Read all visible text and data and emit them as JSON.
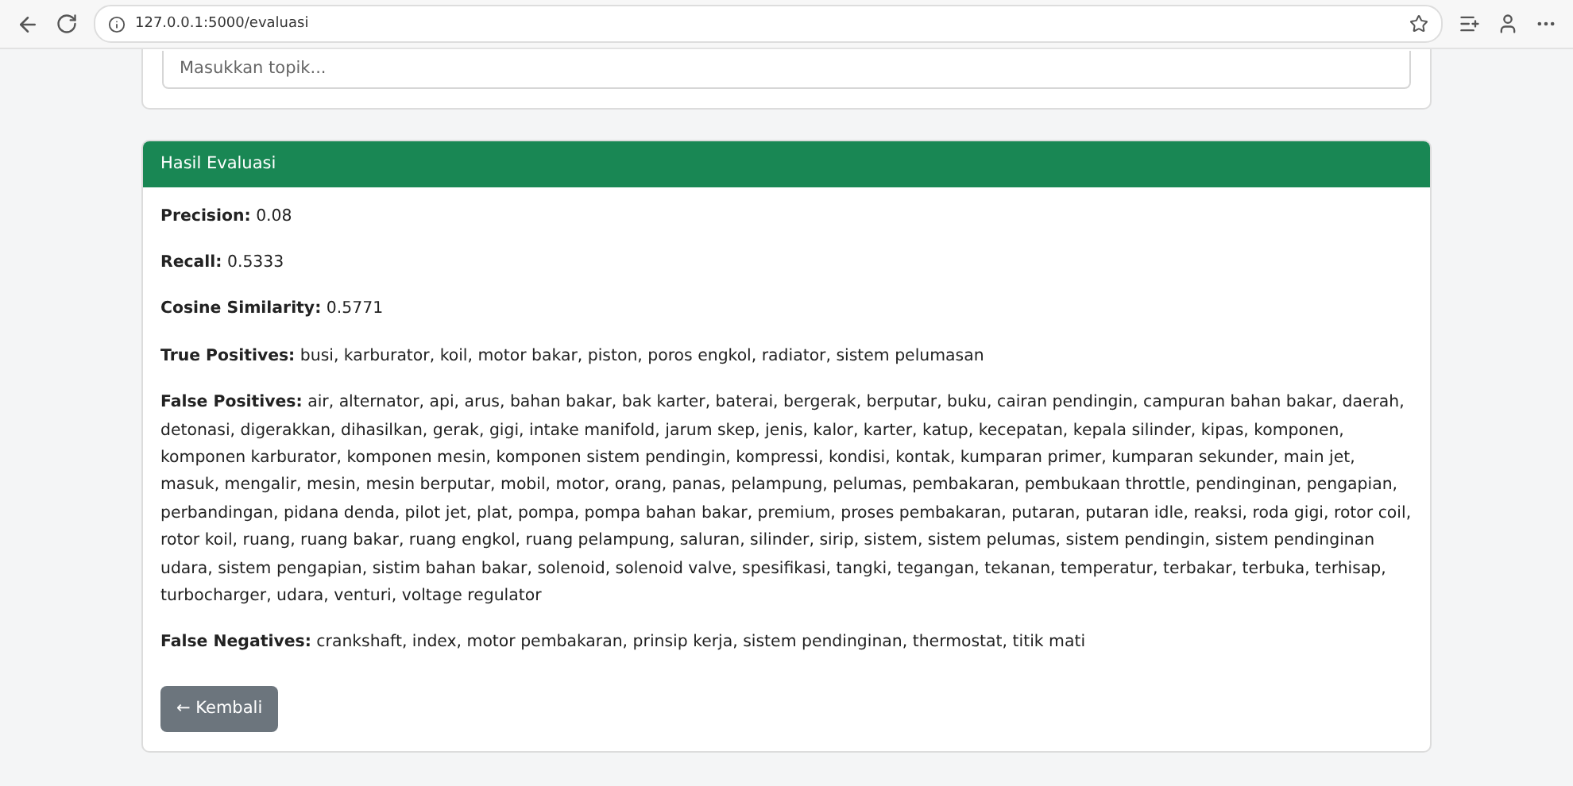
{
  "browser": {
    "url": "127.0.0.1:5000/evaluasi"
  },
  "topic_form": {
    "placeholder": "Masukkan topik..."
  },
  "results": {
    "title": "Hasil Evaluasi",
    "metrics": [
      {
        "label": "Precision:",
        "value": "0.08"
      },
      {
        "label": "Recall:",
        "value": "0.5333"
      },
      {
        "label": "Cosine Similarity:",
        "value": "0.5771"
      },
      {
        "label": "True Positives:",
        "value": "busi, karburator, koil, motor bakar, piston, poros engkol, radiator, sistem pelumasan"
      },
      {
        "label": "False Positives:",
        "value": "air, alternator, api, arus, bahan bakar, bak karter, baterai, bergerak, berputar, buku, cairan pendingin, campuran bahan bakar, daerah, detonasi, digerakkan, dihasilkan, gerak, gigi, intake manifold, jarum skep, jenis, kalor, karter, katup, kecepatan, kepala silinder, kipas, komponen, komponen karburator, komponen mesin, komponen sistem pendingin, kompressi, kondisi, kontak, kumparan primer, kumparan sekunder, main jet, masuk, mengalir, mesin, mesin berputar, mobil, motor, orang, panas, pelampung, pelumas, pembakaran, pembukaan throttle, pendinginan, pengapian, perbandingan, pidana denda, pilot jet, plat, pompa, pompa bahan bakar, premium, proses pembakaran, putaran, putaran idle, reaksi, roda gigi, rotor coil, rotor koil, ruang, ruang bakar, ruang engkol, ruang pelampung, saluran, silinder, sirip, sistem, sistem pelumas, sistem pendingin, sistem pendinginan udara, sistem pengapian, sistim bahan bakar, solenoid, solenoid valve, spesifikasi, tangki, tegangan, tekanan, temperatur, terbakar, terbuka, terhisap, turbocharger, udara, venturi, voltage regulator"
      },
      {
        "label": "False Negatives:",
        "value": "crankshaft, index, motor pembakaran, prinsip kerja, sistem pendinginan, thermostat, titik mati"
      }
    ],
    "back_button": "← Kembali"
  }
}
